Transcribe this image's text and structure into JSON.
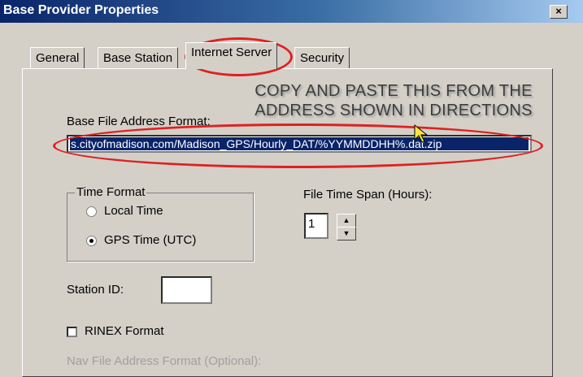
{
  "window": {
    "title": "Base Provider Properties",
    "close_label": "×"
  },
  "tabs": [
    {
      "label": "General"
    },
    {
      "label": "Base Station"
    },
    {
      "label": "Internet Server"
    },
    {
      "label": "Security"
    }
  ],
  "annotation": {
    "line1": "COPY AND PASTE THIS FROM THE",
    "line2": "ADDRESS SHOWN IN DIRECTIONS",
    "color": "#3c3c3c"
  },
  "address": {
    "label": "Base File Address Format:",
    "value": "s.cityofmadison.com/Madison_GPS/Hourly_DAT/%YYMMDDHH%.dat.zip"
  },
  "time_format": {
    "legend": "Time Format",
    "options": [
      {
        "label": "Local Time",
        "selected": false
      },
      {
        "label": "GPS Time (UTC)",
        "selected": true
      }
    ]
  },
  "file_time_span": {
    "label": "File Time Span (Hours):",
    "value": "1"
  },
  "station_id": {
    "label": "Station ID:",
    "value": ""
  },
  "rinex": {
    "label": "RINEX Format",
    "checked": false
  },
  "nav_address": {
    "label": "Nav File Address Format (Optional):"
  },
  "highlight_color": "#e02020"
}
